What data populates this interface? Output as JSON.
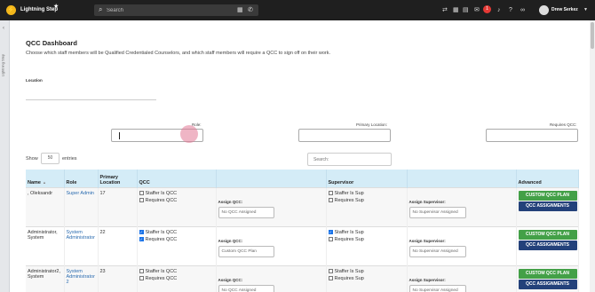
{
  "topbar": {
    "logo_letter": "⚡",
    "app_name": "Lightning Step",
    "search_placeholder": "Search",
    "notifications_count": "1",
    "user_name": "Drew Serkez"
  },
  "sidebar": {
    "vertical_label": "Lightning Step"
  },
  "page": {
    "title": "QCC Dashboard",
    "subtitle": "Choose which staff members will be Qualified Credentialed Counselors, and which staff members will require a QCC to sign off on their work.",
    "location_label": "Location"
  },
  "filters": {
    "role_label": "Role:",
    "primary_location_label": "Primary Location:",
    "requires_qcc_label": "Requires QCC:"
  },
  "table_controls": {
    "show_label": "Show",
    "entries_value": "50",
    "entries_label": "entries",
    "search_placeholder": "Search:"
  },
  "table": {
    "headers": [
      "Name",
      "Role",
      "Primary Location",
      "QCC",
      "",
      "Supervisor",
      "",
      "Advanced"
    ],
    "rows": [
      {
        "name": ", Oleksandr",
        "role": "Super Admin",
        "location": "17",
        "staffer_is_qcc": "Staffer Is QCC",
        "requires_qcc": "Requires QCC",
        "assign_qcc_label": "Assign QCC:",
        "assign_qcc_value": "No QCC Assigned",
        "staffer_is_sup": "Staffer Is Sup",
        "requires_sup": "Requires Sup",
        "assign_sup_label": "Assign Supervisor:",
        "assign_sup_value": "No Supervisor Assigned",
        "btn1": "CUSTOM QCC PLAN",
        "btn2": "QCC ASSIGNMENTS"
      },
      {
        "name": "Administrator, System",
        "role": "System Administrator",
        "location": "22",
        "staffer_is_qcc": "Staffer Is QCC",
        "requires_qcc": "Requires QCC",
        "assign_qcc_label": "Assign QCC:",
        "assign_qcc_value": "Custom QCC Plan",
        "staffer_is_sup": "Staffer Is Sup",
        "requires_sup": "Requires Sup",
        "assign_sup_label": "Assign Supervisor:",
        "assign_sup_value": "No Supervisor Assigned",
        "btn1": "CUSTOM QCC PLAN",
        "btn2": "QCC ASSIGNMENTS"
      },
      {
        "name": "Administrator2, System",
        "role": "System Administrator 2",
        "location": "23",
        "staffer_is_qcc": "Staffer Is QCC",
        "requires_qcc": "Requires QCC",
        "assign_qcc_label": "Assign QCC:",
        "assign_qcc_value": "No QCC Assigned",
        "staffer_is_sup": "Staffer Is Sup",
        "requires_sup": "Requires Sup",
        "assign_sup_label": "Assign Supervisor:",
        "assign_sup_value": "No Supervisor Assigned",
        "btn1": "CUSTOM QCC PLAN",
        "btn2": "QCC ASSIGNMENTS"
      }
    ]
  },
  "colors": {
    "topbar": "#1f1f1f",
    "header_row": "#d4ecf7",
    "green_button": "#43a047",
    "navy_button": "#23417a",
    "badge": "#e53935"
  }
}
